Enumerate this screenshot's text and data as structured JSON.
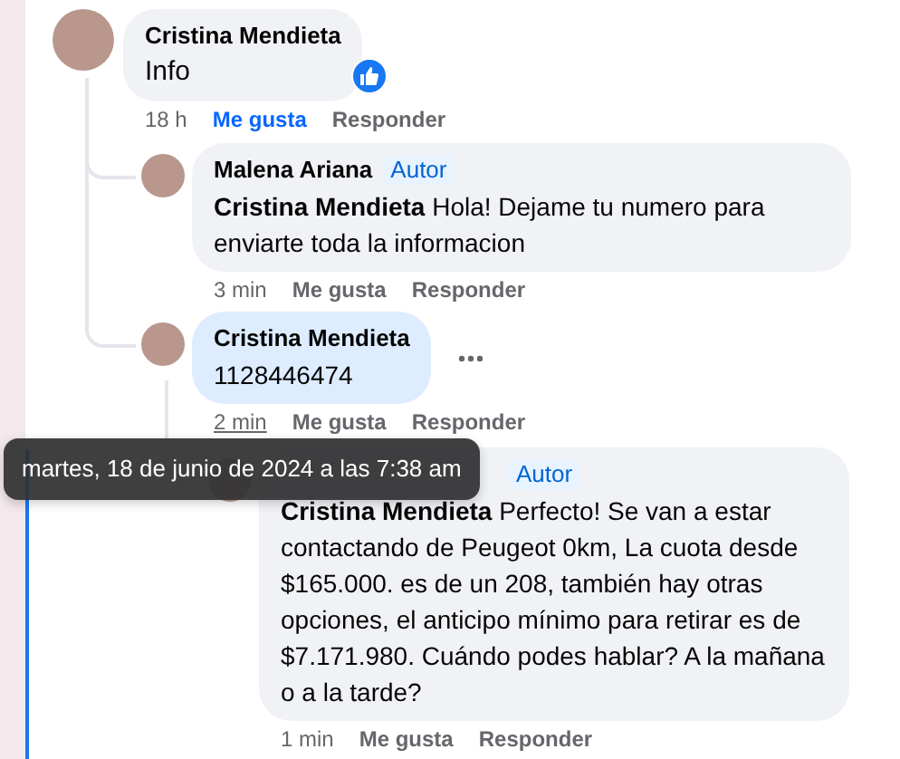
{
  "comments": [
    {
      "author": "Cristina Mendieta",
      "text": "Info",
      "time": "18 h",
      "like": "Me gusta",
      "reply": "Responder",
      "liked": true,
      "reacted": true,
      "highlighted": false,
      "hovered": false,
      "children": [
        {
          "author": "Malena Ariana",
          "badge": "Autor",
          "text": "**Cristina Mendieta** Hola! Dejame tu numero para enviarte toda la informacion",
          "time": "3 min",
          "like": "Me gusta",
          "reply": "Responder",
          "liked": false,
          "reacted": false,
          "highlighted": false,
          "hovered": false
        },
        {
          "author": "Cristina Mendieta",
          "text": "1128446474",
          "time": "2 min",
          "like": "Me gusta",
          "reply": "Responder",
          "liked": false,
          "reacted": false,
          "highlighted": true,
          "hovered": true,
          "more": true,
          "children": [
            {
              "badge": "Autor",
              "text": "**Cristina Mendieta** Perfecto! Se van a estar contactando de Peugeot 0km, La cuota desde $165.000. es de un 208, también hay otras opciones, el anticipo mínimo para retirar es de $7.171.980. Cuándo podes hablar? A la mañana o a la tarde?",
              "time": "1 min",
              "like": "Me gusta",
              "reply": "Responder",
              "liked": false,
              "reacted": false,
              "highlighted": false,
              "hovered": false
            }
          ]
        }
      ]
    }
  ],
  "tooltip": {
    "text": "martes, 18 de junio de 2024 a las 7:38 am"
  }
}
